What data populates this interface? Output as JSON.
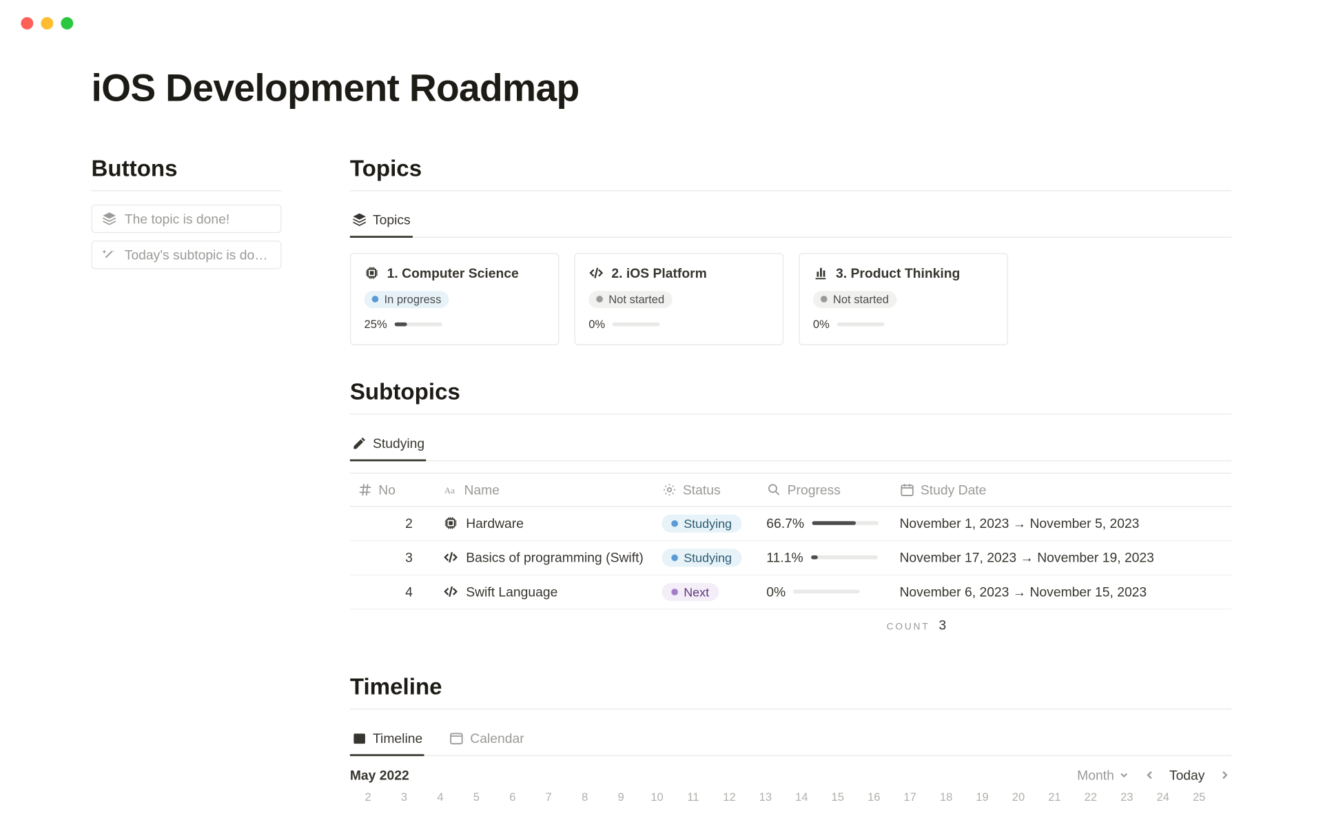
{
  "page_title": "iOS Development Roadmap",
  "buttons": {
    "heading": "Buttons",
    "items": [
      {
        "label": "The topic is done!"
      },
      {
        "label": "Today's subtopic is do…"
      }
    ]
  },
  "topics": {
    "heading": "Topics",
    "tab_label": "Topics",
    "cards": [
      {
        "icon": "chip-icon",
        "title": "1. Computer Science",
        "status": "In progress",
        "status_class": "in-progress",
        "progress_text": "25%",
        "progress_pct": 25
      },
      {
        "icon": "code-icon",
        "title": "2. iOS Platform",
        "status": "Not started",
        "status_class": "",
        "progress_text": "0%",
        "progress_pct": 0
      },
      {
        "icon": "chart-icon",
        "title": "3. Product Thinking",
        "status": "Not started",
        "status_class": "",
        "progress_text": "0%",
        "progress_pct": 0
      }
    ]
  },
  "subtopics": {
    "heading": "Subtopics",
    "tab_label": "Studying",
    "columns": {
      "no": "No",
      "name": "Name",
      "status": "Status",
      "progress": "Progress",
      "study_date": "Study Date"
    },
    "rows": [
      {
        "no": "2",
        "icon": "chip-icon",
        "name": "Hardware",
        "status": "Studying",
        "status_class": "studying",
        "progress_text": "66.7%",
        "progress_pct": 66.7,
        "study_date": "November 1, 2023 → November 5, 2023"
      },
      {
        "no": "3",
        "icon": "code-icon",
        "name": "Basics of programming (Swift)",
        "status": "Studying",
        "status_class": "studying",
        "progress_text": "11.1%",
        "progress_pct": 11.1,
        "study_date": "November 17, 2023 → November 19, 2023"
      },
      {
        "no": "4",
        "icon": "code-icon",
        "name": "Swift Language",
        "status": "Next",
        "status_class": "next",
        "progress_text": "0%",
        "progress_pct": 0,
        "study_date": "November 6, 2023 → November 15, 2023"
      }
    ],
    "count_label": "COUNT",
    "count_value": "3"
  },
  "timeline": {
    "heading": "Timeline",
    "tabs": [
      {
        "label": "Timeline",
        "active": true
      },
      {
        "label": "Calendar",
        "active": false
      }
    ],
    "month_label": "May 2022",
    "scale_label": "Month",
    "today_label": "Today",
    "days": [
      "2",
      "3",
      "4",
      "5",
      "6",
      "7",
      "8",
      "9",
      "10",
      "11",
      "12",
      "13",
      "14",
      "15",
      "16",
      "17",
      "18",
      "19",
      "20",
      "21",
      "22",
      "23",
      "24",
      "25"
    ]
  }
}
